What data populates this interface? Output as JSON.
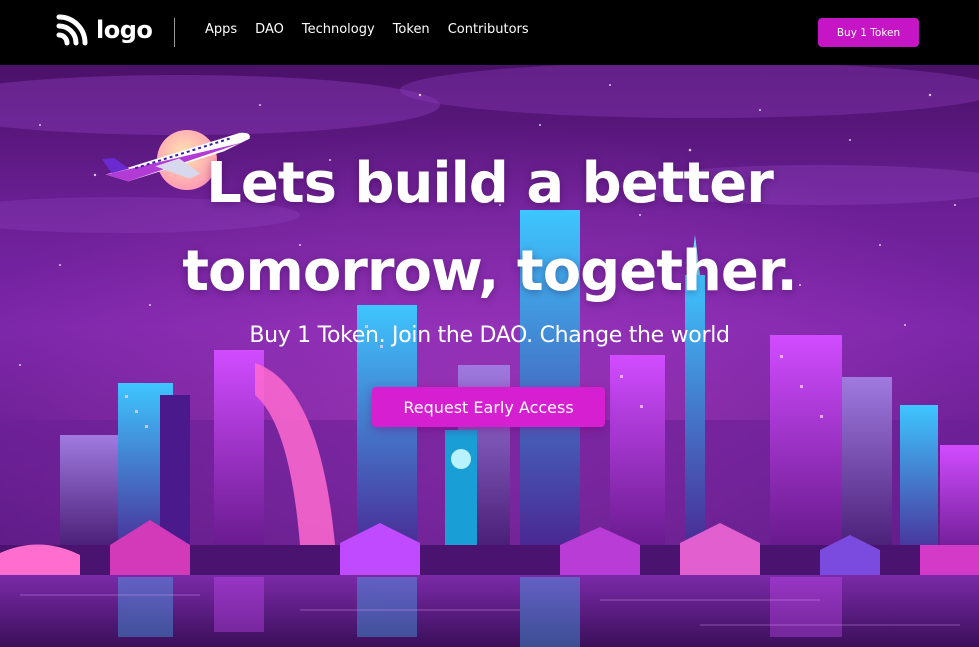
{
  "nav": {
    "logo_text": "logo",
    "links": [
      "Apps",
      "DAO",
      "Technology",
      "Token",
      "Contributors"
    ],
    "buy_label": "Buy 1 Token"
  },
  "hero": {
    "title_line_1": "Lets build a better",
    "title_line_2": "tomorrow, together.",
    "subtitle": "Buy 1 Token. Join the DAO. Change the world",
    "cta_label": "Request Early Access"
  },
  "colors": {
    "accent": "#c515c5",
    "cta": "#d61fd1",
    "navbar_bg": "#000000",
    "sky_top": "#4a1168",
    "sky_mid": "#7a25a8"
  },
  "icons": {
    "logo": "rss-wifi-icon"
  }
}
